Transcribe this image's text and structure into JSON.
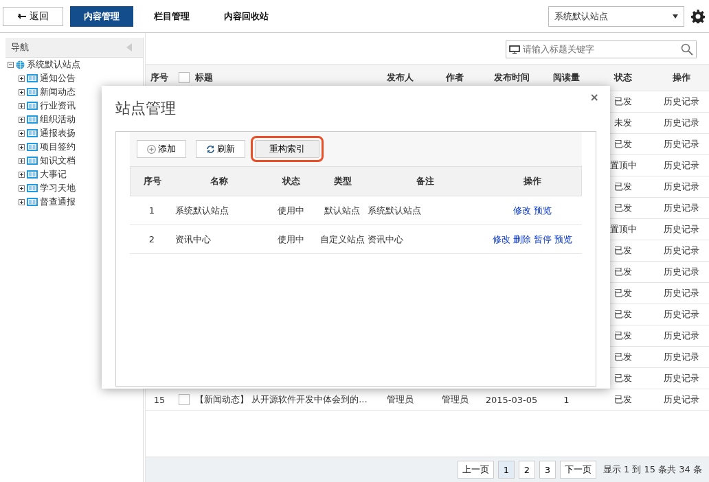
{
  "topbar": {
    "back_button": "返回",
    "tabs": [
      {
        "label": "内容管理",
        "selected": true
      },
      {
        "label": "栏目管理",
        "selected": false
      },
      {
        "label": "内容回收站",
        "selected": false
      }
    ],
    "site_select": {
      "value": "系统默认站点"
    }
  },
  "sidebar": {
    "title": "导航",
    "tree": [
      {
        "label": "系统默认站点",
        "expanded": true,
        "children": [
          {
            "label": "通知公告",
            "expanded": false
          },
          {
            "label": "新闻动态",
            "expanded": false
          },
          {
            "label": "行业资讯",
            "expanded": false
          },
          {
            "label": "组织活动",
            "expanded": false
          },
          {
            "label": "通报表扬",
            "expanded": false
          },
          {
            "label": "项目签约",
            "expanded": false
          },
          {
            "label": "知识文档",
            "expanded": false
          },
          {
            "label": "大事记",
            "expanded": false
          },
          {
            "label": "学习天地",
            "expanded": false
          },
          {
            "label": "督查通报",
            "expanded": false
          }
        ]
      }
    ]
  },
  "search": {
    "placeholder": "请输入标题关键字"
  },
  "table": {
    "select_all": {
      "checked": false
    },
    "columns": [
      "序号",
      "标题",
      "发布人",
      "作者",
      "发布时间",
      "阅读量",
      "状态",
      "操作"
    ],
    "rows": [
      {
        "status": "已发",
        "action": "历史记录"
      },
      {
        "status": "未发",
        "action": "历史记录"
      },
      {
        "status": "已发",
        "action": "历史记录"
      },
      {
        "status": "置顶中",
        "action": "历史记录"
      },
      {
        "status": "已发",
        "action": "历史记录"
      },
      {
        "status": "已发",
        "action": "历史记录"
      },
      {
        "status": "置顶中",
        "action": "历史记录"
      },
      {
        "status": "已发",
        "action": "历史记录"
      },
      {
        "status": "已发",
        "action": "历史记录"
      },
      {
        "status": "已发",
        "action": "历史记录"
      },
      {
        "status": "已发",
        "action": "历史记录"
      },
      {
        "status": "已发",
        "action": "历史记录"
      },
      {
        "status": "已发",
        "action": "历史记录"
      },
      {
        "status": "已发",
        "action": "历史记录"
      },
      {
        "no": "15",
        "checked": false,
        "title": "【新闻动态】 从开源软件开发中体会到的...",
        "publisher": "管理员",
        "author": "管理员",
        "date": "2015-03-05",
        "reads": "1",
        "status": "已发",
        "action": "历史记录"
      }
    ]
  },
  "pagination": {
    "prev": "上一页",
    "pages": [
      {
        "label": "1",
        "selected": true
      },
      {
        "label": "2",
        "selected": false
      },
      {
        "label": "3",
        "selected": false
      }
    ],
    "next": "下一页",
    "summary": "显示 1 到 15 条共 34 条"
  },
  "dialog": {
    "title": "站点管理",
    "close": "×",
    "toolbar": [
      {
        "kind": "add",
        "label": "添加",
        "highlighted": false
      },
      {
        "kind": "refresh",
        "label": "刷新",
        "highlighted": false
      },
      {
        "kind": "plain",
        "label": "重构索引",
        "highlighted": true
      }
    ],
    "columns": [
      "序号",
      "名称",
      "状态",
      "类型",
      "备注",
      "操作"
    ],
    "rows": [
      {
        "no": "1",
        "name": "系统默认站点",
        "status": "使用中",
        "type": "默认站点",
        "note": "系统默认站点",
        "actions": [
          "修改",
          "预览"
        ]
      },
      {
        "no": "2",
        "name": "资讯中心",
        "status": "使用中",
        "type": "自定义站点",
        "note": "资讯中心",
        "actions": [
          "修改",
          "删除",
          "暂停",
          "预览"
        ]
      }
    ]
  }
}
